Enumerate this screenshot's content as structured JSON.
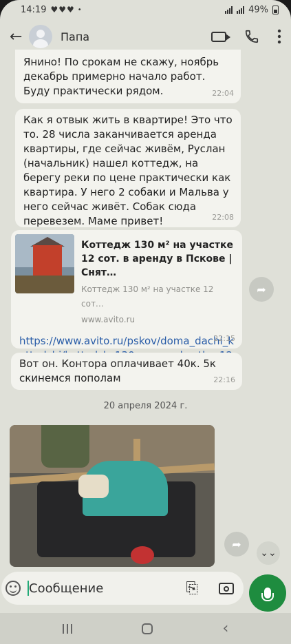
{
  "status_bar": {
    "time": "14:19",
    "hearts": "♥♥♥",
    "battery": "49%"
  },
  "header": {
    "contact_name": "Папа"
  },
  "messages": [
    {
      "text": "Янино! По срокам не скажу, ноябрь декабрь примерно начало работ. Буду практически рядом.",
      "time": "22:04"
    },
    {
      "text": "Как я отвык жить в квартире! Это что то. 28 числа заканчивается аренда квартиры, где сейчас живём,   Руслан (начальник) нашел коттедж, на берегу реки по цене практически как квартира. У него 2 собаки и Мальва у него сейчас живёт. Собак сюда перевезем. Маме привет!",
      "time": "22:08"
    },
    {
      "link_title": "Коттедж 130 м² на участке 12 сот. в аренду в Пскове | Снят…",
      "link_subtitle": "Коттедж 130 м² на участке 12 сот…",
      "link_host": "www.avito.ru",
      "url": "https://www.avito.ru/pskov/doma_dachi_kottedzhi/kottedzh_130m_na_uchastke_12sot._2754379574",
      "time": "22:15"
    },
    {
      "text": "Вот он. Контора оплачивает 40к. 5к скинемся пополам",
      "time": "22:16"
    }
  ],
  "date_separator": "20 апреля 2024 г.",
  "composer": {
    "placeholder": "Сообщение"
  },
  "icons": {
    "back": "back-arrow-icon",
    "video": "video-call-icon",
    "phone": "phone-icon",
    "more": "more-vert-icon",
    "share": "share-icon",
    "scroll": "scroll-down-icon",
    "emoji": "emoji-icon",
    "attach": "attach-icon",
    "camera": "camera-icon",
    "mic": "mic-icon"
  },
  "colors": {
    "mic_button": "#1e8c3f",
    "link": "#2a5da8",
    "bubble": "#f3f3ee",
    "background": "#dfe0d8"
  }
}
